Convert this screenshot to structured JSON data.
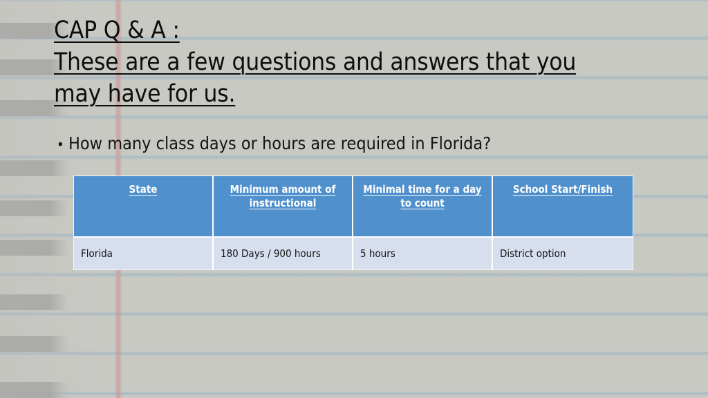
{
  "slide": {
    "title_lines": [
      "CAP Q & A :",
      "These are a few questions and answers that you",
      "may have for us."
    ],
    "bullet": {
      "marker": "•",
      "text": "How many class days or hours are required in Florida?"
    }
  },
  "table": {
    "headers": [
      "State",
      "Minimum amount of instructional",
      "Minimal time for a day to count",
      "School Start/Finish"
    ],
    "rows": [
      [
        "Florida",
        "180 Days / 900 hours",
        "5 hours",
        "District option"
      ]
    ]
  },
  "theme": {
    "slide_background": "#c9c9c4",
    "header_blue": "#4f90cd",
    "row_blue": "#d7dfee",
    "accent_line_blue": "#96b2c3",
    "accent_stripe_pink": "#c7a09d",
    "sidebar_bar_gray": "#a3a3a1",
    "text_dark": "#111111",
    "text_light": "#ffffff"
  },
  "decor": {
    "blue_line_tops": [
      -4,
      52,
      109,
      166,
      224,
      281,
      337,
      394,
      451,
      508,
      566
    ],
    "gray_bar_tops": [
      33,
      86,
      145,
      232,
      290,
      347,
      426,
      486,
      553
    ],
    "gray_bar_widths": [
      100,
      100,
      100,
      102,
      100,
      100,
      100,
      100,
      100
    ]
  }
}
